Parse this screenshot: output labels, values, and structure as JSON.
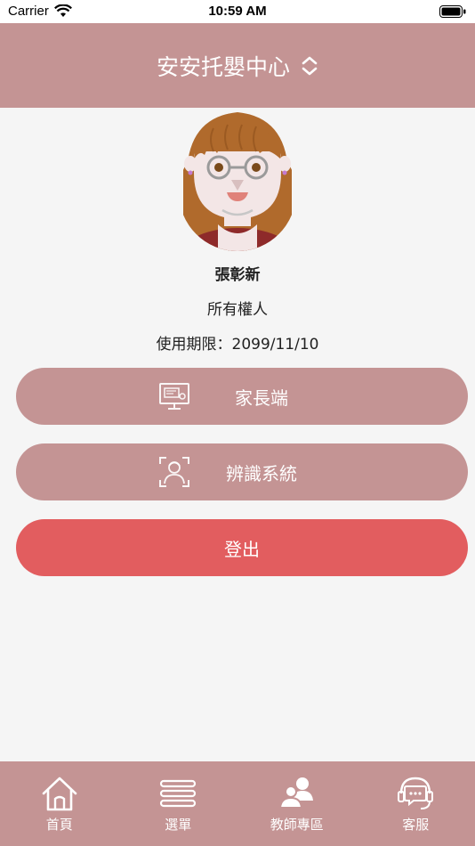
{
  "status_bar": {
    "carrier": "Carrier",
    "time": "10:59 AM"
  },
  "header": {
    "title": "安安托嬰中心"
  },
  "profile": {
    "name": "張彰新",
    "role": "所有權人",
    "expiry": "使用期限：2099/11/10"
  },
  "buttons": {
    "parent_label": "家長端",
    "recognition_label": "辨識系統",
    "logout_label": "登出"
  },
  "tabbar": {
    "items": [
      {
        "label": "首頁",
        "icon": "home-icon"
      },
      {
        "label": "選單",
        "icon": "menu-icon"
      },
      {
        "label": "教師專區",
        "icon": "teachers-icon"
      },
      {
        "label": "客服",
        "icon": "support-chat-icon"
      }
    ]
  },
  "colors": {
    "header_bg": "#c49494",
    "button_bg": "#c49494",
    "logout_bg": "#e25d5f",
    "background": "#f5f5f5"
  }
}
